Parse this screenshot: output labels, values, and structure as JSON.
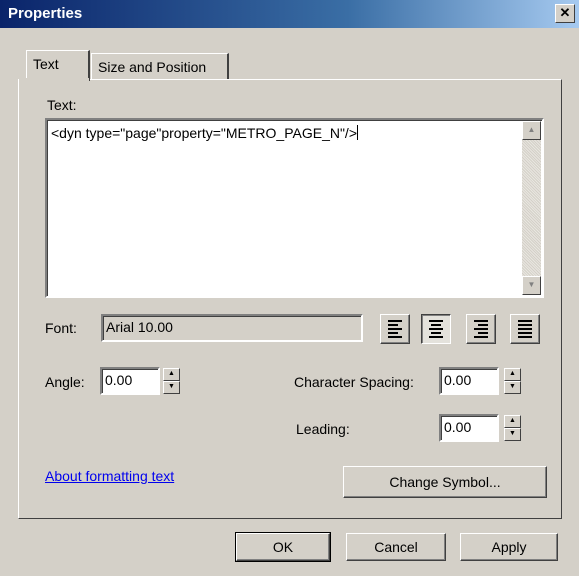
{
  "window": {
    "title": "Properties",
    "close_glyph": "✕"
  },
  "tabs": [
    {
      "label": "Text",
      "active": true
    },
    {
      "label": "Size and Position",
      "active": false
    }
  ],
  "text_section": {
    "label": "Text:",
    "value": "<dyn type=\"page\"property=\"METRO_PAGE_N\"/>",
    "scroll_up_icon": "▲",
    "scroll_down_icon": "▼"
  },
  "font": {
    "label": "Font:",
    "value": "Arial 10.00"
  },
  "alignment": {
    "options": [
      "align-left",
      "align-center",
      "align-right",
      "align-justify"
    ],
    "selected": "align-center"
  },
  "angle": {
    "label": "Angle:",
    "value": "0.00"
  },
  "character_spacing": {
    "label": "Character Spacing:",
    "value": "0.00"
  },
  "leading": {
    "label": "Leading:",
    "value": "0.00"
  },
  "spinner": {
    "up_icon": "▲",
    "down_icon": "▼"
  },
  "link": {
    "label": "About formatting text"
  },
  "change_symbol_button": {
    "label": "Change Symbol..."
  },
  "footer": {
    "ok_label": "OK",
    "cancel_label": "Cancel",
    "apply_label": "Apply"
  }
}
